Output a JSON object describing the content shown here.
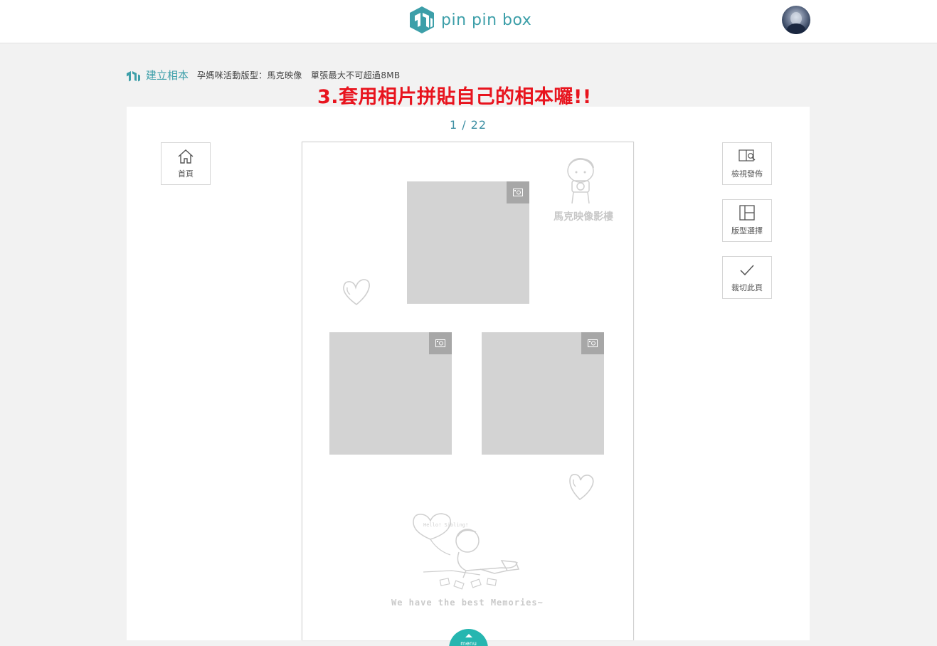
{
  "header": {
    "brand": "pin pin box"
  },
  "breadcrumb": {
    "title": "建立相本",
    "subtitle": "孕媽咪活動版型：馬克映像　單張最大不可超過8MB"
  },
  "annotation": "3.套用相片拼貼自己的相本囉!!",
  "editor": {
    "pager": "1 / 22",
    "toolbar_left": [
      {
        "icon": "home-icon",
        "label": "首頁"
      }
    ],
    "toolbar_right": [
      {
        "icon": "preview-publish-icon",
        "label": "檢視發佈"
      },
      {
        "icon": "layout-icon",
        "label": "版型選擇"
      },
      {
        "icon": "check-icon",
        "label": "裁切此頁"
      }
    ],
    "page": {
      "watermark": "馬克映像影樓",
      "footer_text": "We have the best Memories~",
      "balloon_text": "Hello! Sibling!",
      "photo_slots": 3
    }
  },
  "menu": {
    "label": "menu"
  },
  "colors": {
    "brand": "#3d9fa9",
    "annotation": "#e8141e",
    "menu": "#26b6b0",
    "slot": "#d3d3d3"
  }
}
